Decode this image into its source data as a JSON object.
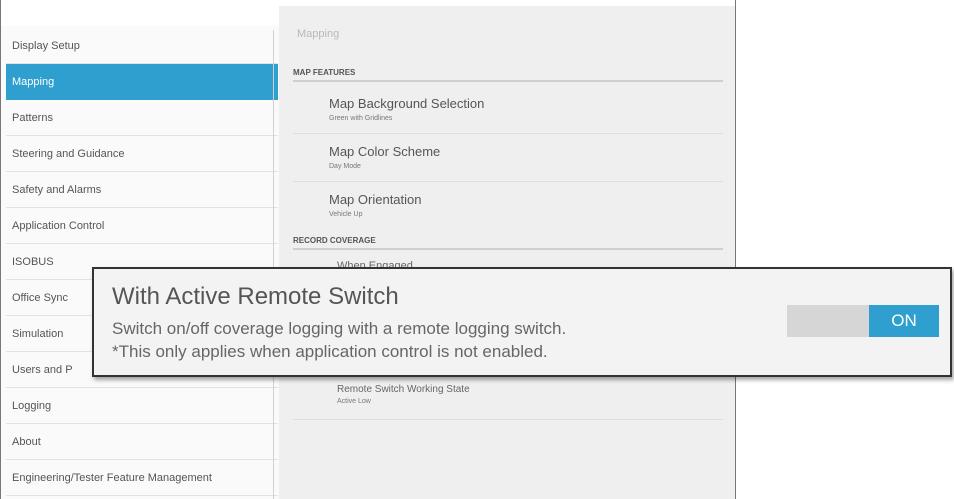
{
  "sidebar": {
    "items": [
      {
        "label": "Display Setup"
      },
      {
        "label": "Mapping"
      },
      {
        "label": "Patterns"
      },
      {
        "label": "Steering and Guidance"
      },
      {
        "label": "Safety and Alarms"
      },
      {
        "label": "Application Control"
      },
      {
        "label": "ISOBUS"
      },
      {
        "label": "Office Sync"
      },
      {
        "label": "Simulation"
      },
      {
        "label": "Users and P"
      },
      {
        "label": "Logging"
      },
      {
        "label": "About"
      },
      {
        "label": "Engineering/Tester Feature Management"
      }
    ],
    "active_index": 1
  },
  "main": {
    "breadcrumb": "Mapping",
    "sections": {
      "map_features": "MAP FEATURES",
      "record_coverage": "RECORD COVERAGE"
    },
    "settings": [
      {
        "title": "Map Background Selection",
        "value": "Green with Gridlines"
      },
      {
        "title": "Map Color Scheme",
        "value": "Day Mode"
      },
      {
        "title": "Map Orientation",
        "value": "Vehicle Up"
      }
    ],
    "partially_hidden": {
      "above": "When Engaged",
      "below_title": "Remote Switch Working State",
      "below_value": "Active Low"
    }
  },
  "callout": {
    "title": "With Active Remote Switch",
    "description_line1": "Switch on/off coverage logging with a remote logging switch.",
    "description_line2": "*This only applies when application control is not enabled.",
    "toggle_state": "ON"
  },
  "colors": {
    "accent": "#2f9fd0"
  }
}
